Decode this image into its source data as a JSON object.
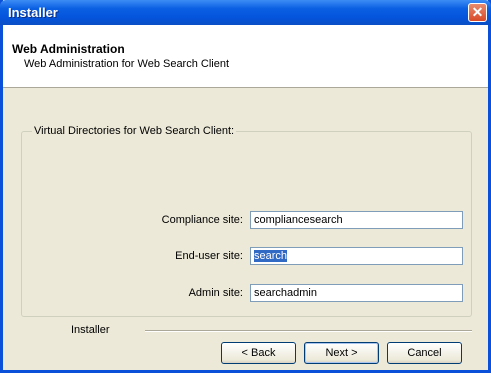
{
  "window": {
    "title": "Installer"
  },
  "header": {
    "title": "Web Administration",
    "subtitle": "Web Administration for Web Search Client"
  },
  "group": {
    "legend": "Virtual Directories for Web Search Client:",
    "fields": [
      {
        "label": "Compliance site:",
        "value": "compliancesearch"
      },
      {
        "label": "End-user site:",
        "value": "search"
      },
      {
        "label": "Admin site:",
        "value": "searchadmin"
      }
    ]
  },
  "footer": {
    "label": "Installer",
    "back": "< Back",
    "next": "Next >",
    "cancel": "Cancel"
  },
  "icons": {
    "close": "close-icon"
  }
}
